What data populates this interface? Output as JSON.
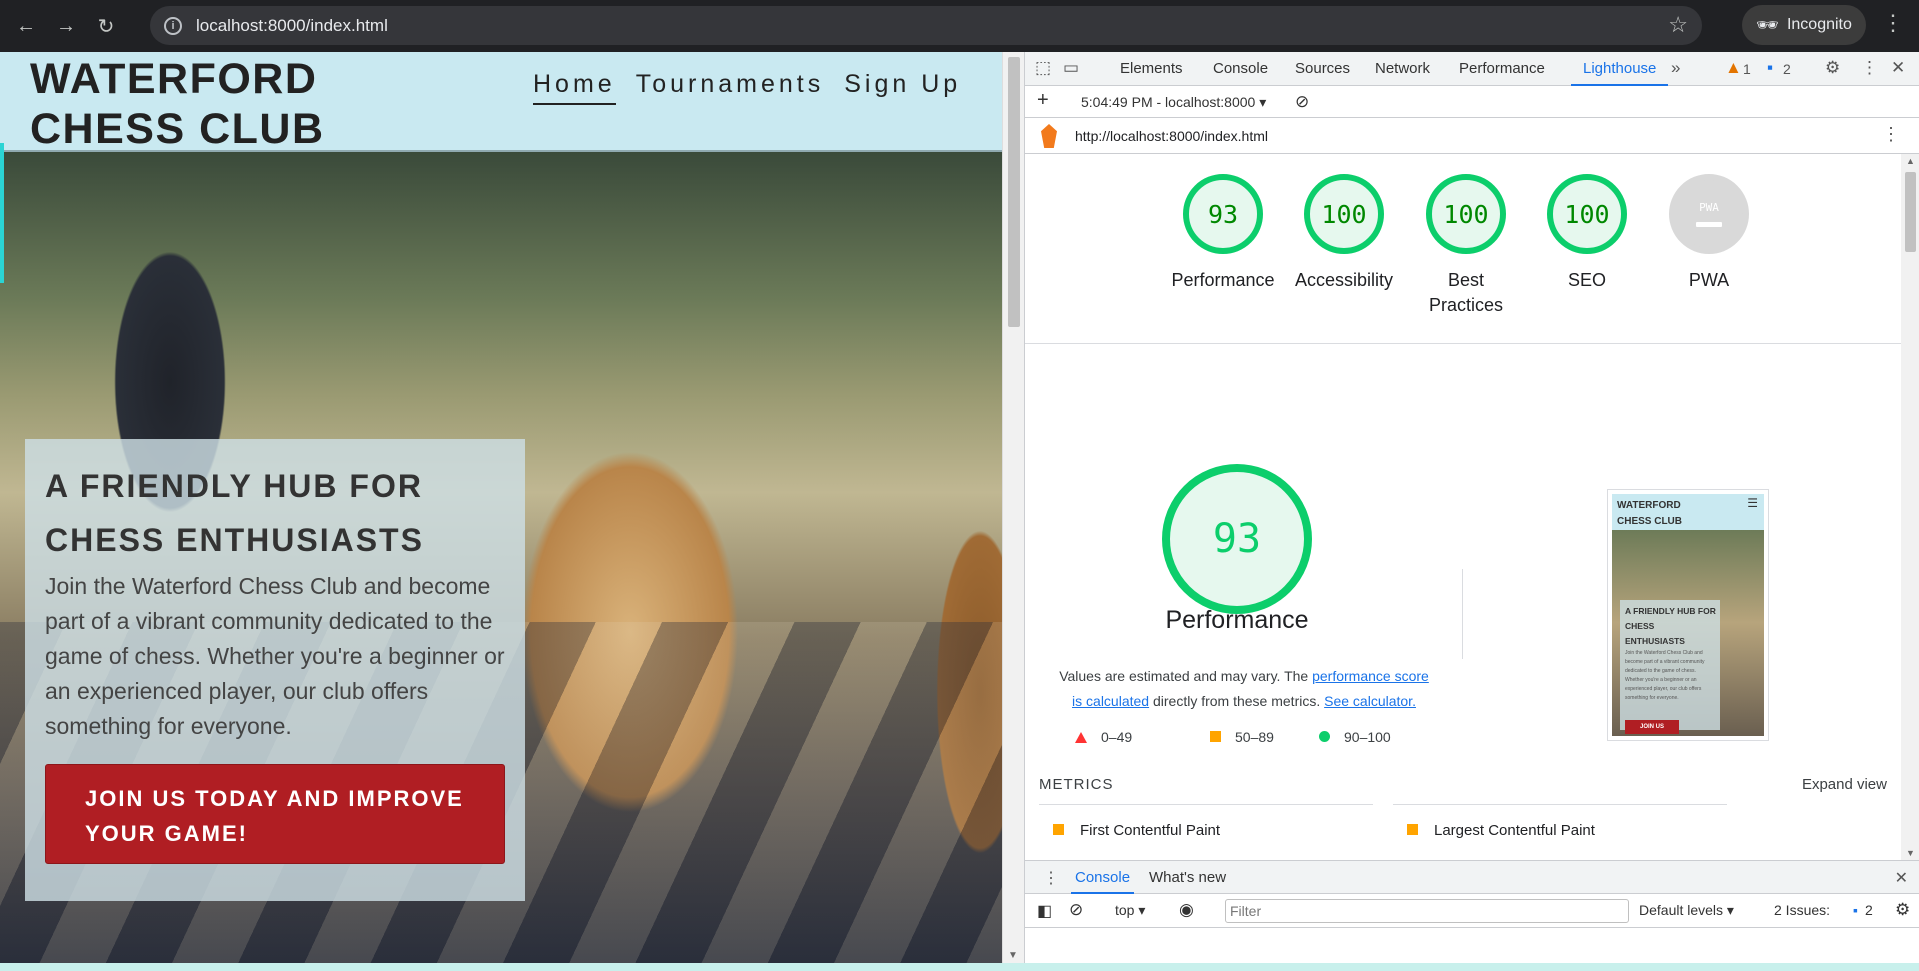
{
  "browser": {
    "url": "localhost:8000/index.html",
    "profile": "Incognito"
  },
  "site": {
    "logo_line1": "WATERFORD",
    "logo_line2": "CHESS CLUB",
    "nav": [
      "Home",
      "Tournaments",
      "Sign Up"
    ],
    "hero_heading_line1": "A FRIENDLY HUB FOR",
    "hero_heading_line2": "CHESS ENTHUSIASTS",
    "hero_text": "Join the Waterford Chess Club and become part of a vibrant community dedicated to the game of chess. Whether you're a beginner or an experienced player, our club offers something for everyone.",
    "cta_line1": "JOIN US TODAY AND IMPROVE",
    "cta_line2": "YOUR GAME!"
  },
  "devtools": {
    "tabs": [
      "Elements",
      "Console",
      "Sources",
      "Network",
      "Performance",
      "Lighthouse"
    ],
    "active_tab": "Lighthouse",
    "warnings_count": "1",
    "messages_count": "2",
    "report_time": "5:04:49 PM - localhost:8000",
    "report_url": "http://localhost:8000/index.html",
    "scores": [
      {
        "label": "Performance",
        "score": "93"
      },
      {
        "label": "Accessibility",
        "score": "100"
      },
      {
        "label": "Best",
        "label2": "Practices",
        "score": "100"
      },
      {
        "label": "SEO",
        "score": "100"
      },
      {
        "label": "PWA",
        "score": "PWA"
      }
    ],
    "performance": {
      "score": "93",
      "title": "Performance",
      "note_prefix": "Values are estimated and may vary. The ",
      "note_link1a": "performance score",
      "note_link1b": "is calculated",
      "note_mid": " directly from these metrics. ",
      "note_link2": "See calculator.",
      "legend": [
        "0–49",
        "50–89",
        "90–100"
      ]
    },
    "thumbnail": {
      "logo": "WATERFORD CHESS CLUB",
      "heading": "A FRIENDLY HUB FOR CHESS ENTHUSIASTS",
      "text": "Join the Waterford Chess Club and become part of a vibrant community dedicated to the game of chess. Whether you're a beginner or an experienced player, our club offers something for everyone.",
      "button": "JOIN US"
    },
    "metrics_label": "METRICS",
    "expand_view": "Expand view",
    "metrics": [
      "First Contentful Paint",
      "Largest Contentful Paint"
    ],
    "drawer_tabs": [
      "Console",
      "What's new"
    ],
    "console": {
      "context": "top",
      "filter_placeholder": "Filter",
      "levels": "Default levels",
      "issues_label": "2 Issues:",
      "issues_count": "2"
    }
  },
  "colors": {
    "brand_red": "#b01e23",
    "header_bg": "#c9e9f1",
    "score_green": "#0cce6b",
    "devtools_accent": "#1a73e8"
  }
}
